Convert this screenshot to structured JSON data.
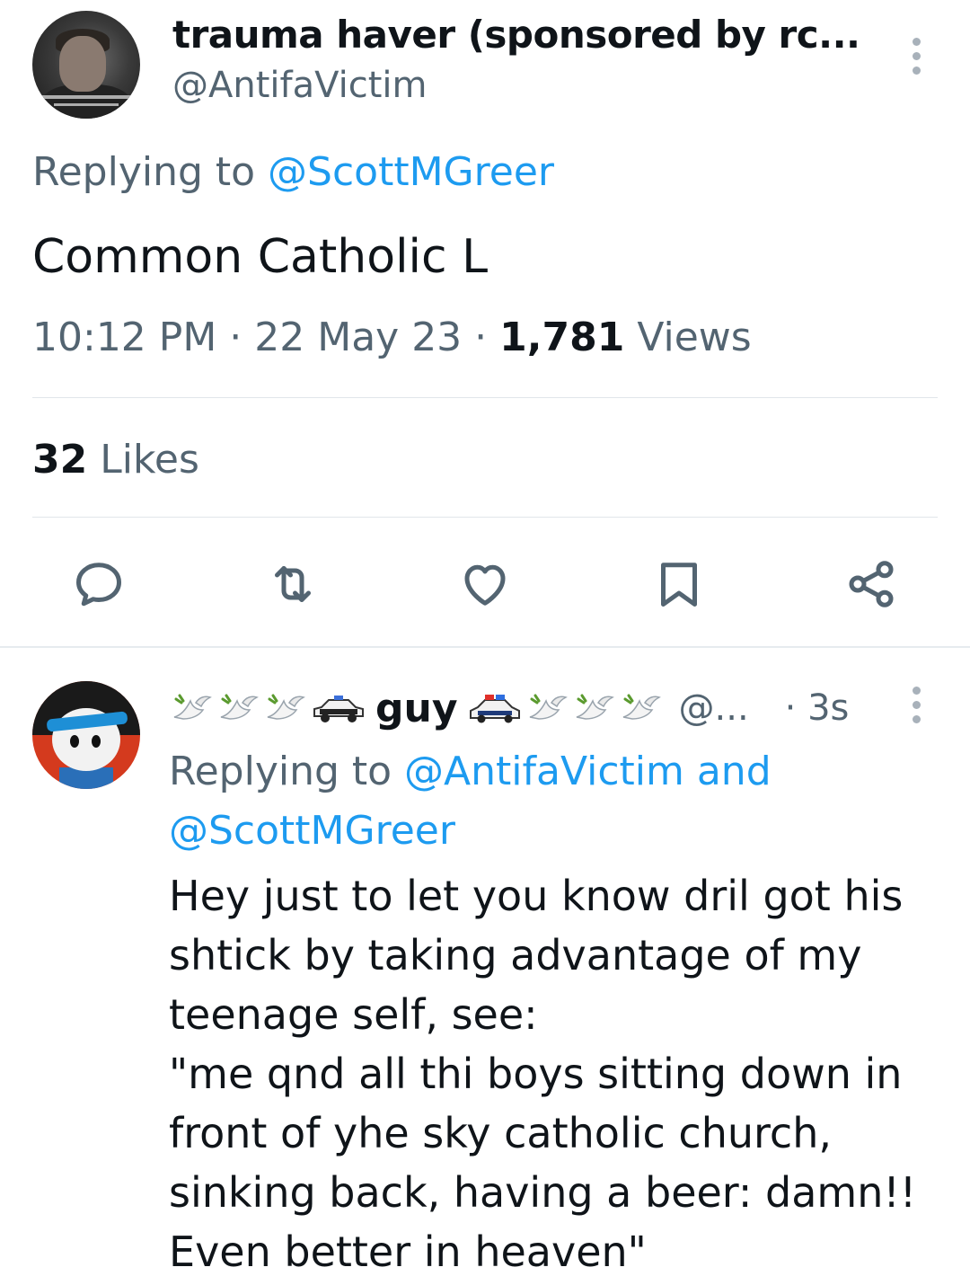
{
  "main_tweet": {
    "author_name": "trauma haver (sponsored by rc...",
    "author_handle": "@AntifaVictim",
    "replying_prefix": "Replying to ",
    "replying_to": "@ScottMGreer",
    "text": "Common Catholic L",
    "time": "10:12 PM",
    "separator": " · ",
    "date": "22 May 23",
    "views_count": "1,781",
    "views_label": " Views",
    "likes_count": "32",
    "likes_label": " Likes",
    "actions": [
      "reply-icon",
      "retweet-icon",
      "like-icon",
      "bookmark-icon",
      "share-icon"
    ]
  },
  "reply_tweet": {
    "author_name": "guy",
    "author_handle": "@...",
    "time": "· 3s",
    "replying_prefix": "Replying to ",
    "replying_to_1": "@AntifaVictim",
    "replying_and": " and",
    "replying_to_2": "@ScottMGreer",
    "text_lines": [
      "Hey just to let you know dril got his",
      "shtick by taking advantage of my",
      "teenage self, see:",
      "\"me qnd all thi boys sitting down in",
      "front of yhe sky catholic church,",
      "sinking back, having a beer: damn!!",
      "Even better in heaven\""
    ],
    "name_emojis_left": [
      "dove-emoji",
      "dove-emoji",
      "dove-emoji",
      "police-car-emoji"
    ],
    "name_emojis_right": [
      "police-car-light-emoji",
      "dove-emoji",
      "dove-emoji",
      "dove-emoji"
    ]
  },
  "colors": {
    "text": "#0f1419",
    "secondary": "#536471",
    "link": "#1d9bf0",
    "divider": "#e1e6ea"
  }
}
